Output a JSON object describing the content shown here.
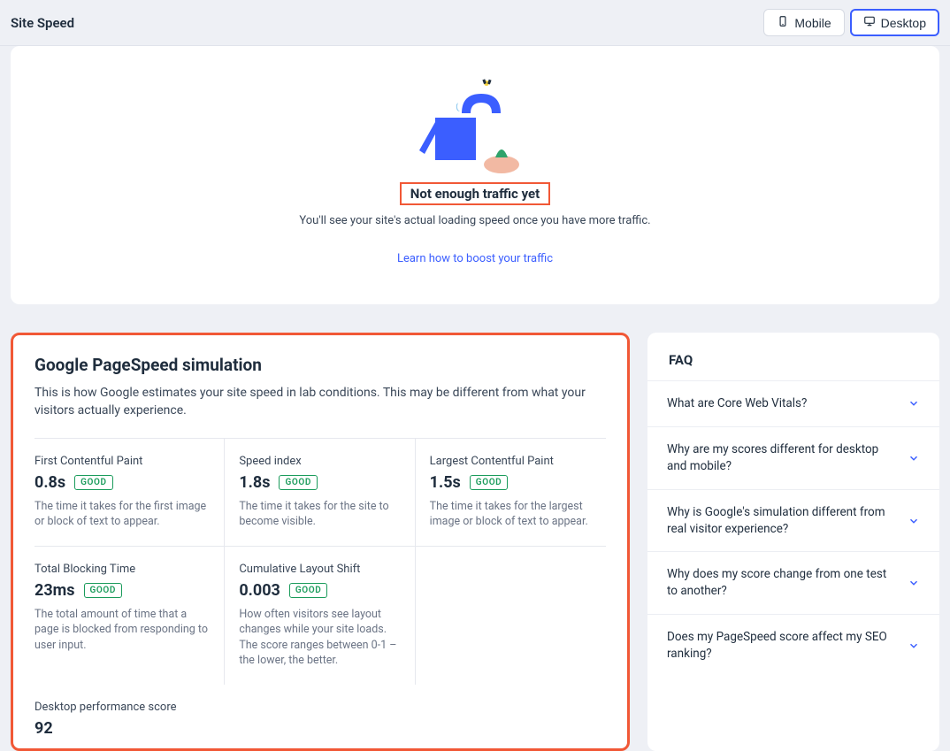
{
  "header": {
    "title": "Site Speed",
    "mobile_label": "Mobile",
    "desktop_label": "Desktop"
  },
  "empty": {
    "heading": "Not enough traffic yet",
    "sub": "You'll see your site's actual loading speed once you have more traffic.",
    "link": "Learn how to boost your traffic"
  },
  "sim": {
    "title": "Google PageSpeed simulation",
    "desc": "This is how Google estimates your site speed in lab conditions. This may be different from what your visitors actually experience.",
    "metrics": [
      {
        "label": "First Contentful Paint",
        "value": "0.8s",
        "badge": "GOOD",
        "desc": "The time it takes for the first image or block of text to appear."
      },
      {
        "label": "Speed index",
        "value": "1.8s",
        "badge": "GOOD",
        "desc": "The time it takes for the site to become visible."
      },
      {
        "label": "Largest Contentful Paint",
        "value": "1.5s",
        "badge": "GOOD",
        "desc": "The time it takes for the largest image or block of text to appear."
      },
      {
        "label": "Total Blocking Time",
        "value": "23ms",
        "badge": "GOOD",
        "desc": "The total amount of time that a page is blocked from responding to user input."
      },
      {
        "label": "Cumulative Layout Shift",
        "value": "0.003",
        "badge": "GOOD",
        "desc": "How often visitors see layout changes while your site loads. The score ranges between 0-1 – the lower, the better."
      }
    ],
    "perf_label": "Desktop performance score",
    "perf_value": "92"
  },
  "faq": {
    "title": "FAQ",
    "items": [
      "What are Core Web Vitals?",
      "Why are my scores different for desktop and mobile?",
      "Why is Google's simulation different from real visitor experience?",
      "Why does my score change from one test to another?",
      "Does my PageSpeed score affect my SEO ranking?"
    ]
  }
}
